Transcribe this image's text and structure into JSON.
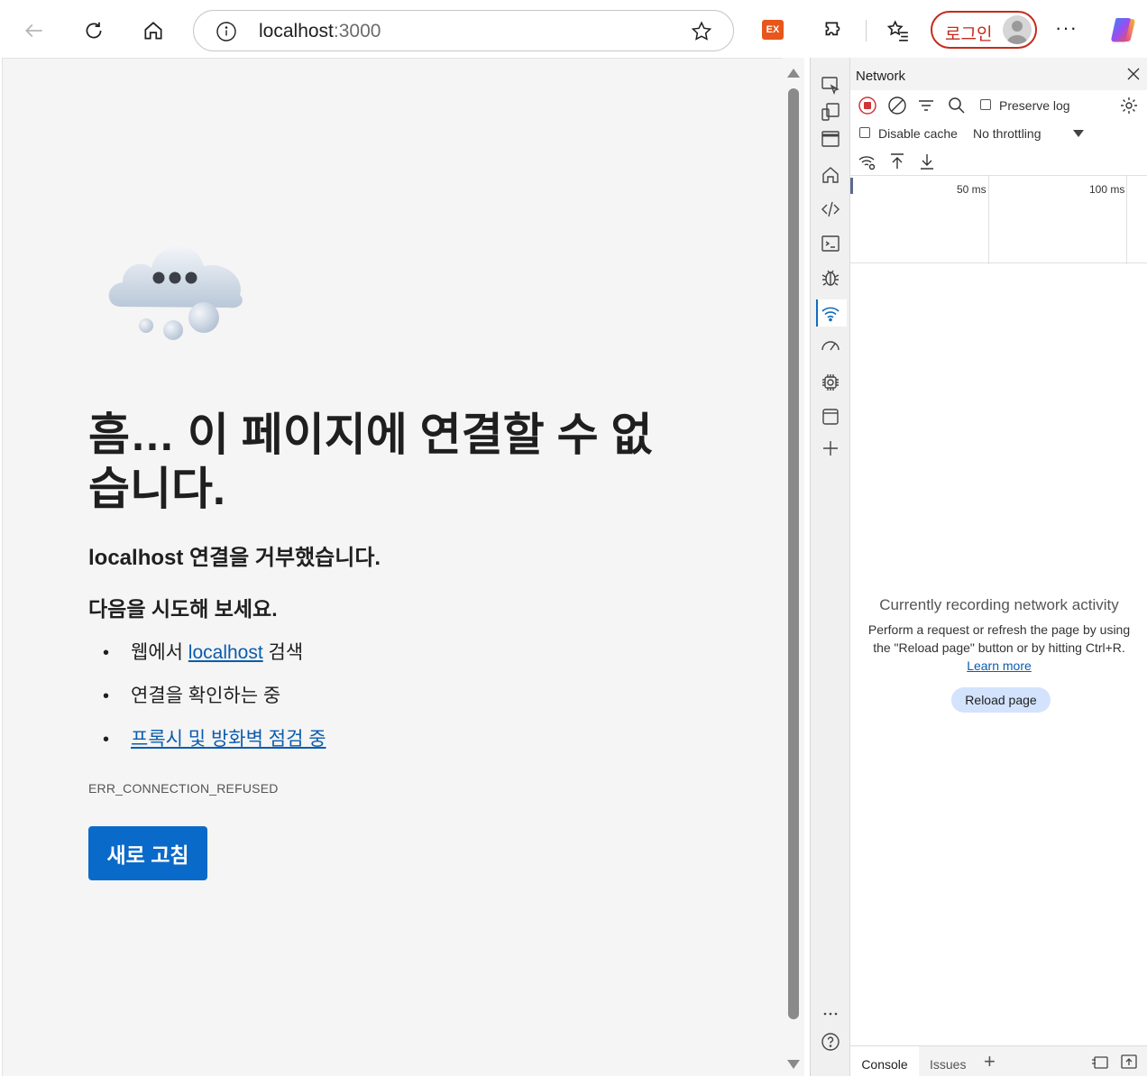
{
  "toolbar": {
    "url_host": "localhost",
    "url_port": ":3000",
    "extension_badge": "EX",
    "login_label": "로그인",
    "more_label": "···"
  },
  "error_page": {
    "title": "흠… 이 페이지에 연결할 수 없습니다.",
    "subtitle": "localhost 연결을 거부했습니다.",
    "subtitle_host": "localhost",
    "subtitle_rest": " 연결을 거부했습니다.",
    "try_heading": "다음을 시도해 보세요.",
    "suggestions": [
      {
        "prefix": "웹에서 ",
        "link": "localhost",
        "suffix": " 검색"
      },
      {
        "prefix": "연결을 확인하는 중",
        "link": "",
        "suffix": ""
      },
      {
        "prefix": "",
        "link": "프록시 및 방화벽 점검 중",
        "suffix": ""
      }
    ],
    "error_code": "ERR_CONNECTION_REFUSED",
    "reload_button": "새로 고침"
  },
  "devtools": {
    "panel_title": "Network",
    "preserve_log_label": "Preserve log",
    "disable_cache_label": "Disable cache",
    "throttling_value": "No throttling",
    "timeline_ticks": [
      "50 ms",
      "100 ms"
    ],
    "empty_title": "Currently recording network activity",
    "empty_desc_before": "Perform a request or refresh the page by using the \"Reload page\" button or by hitting Ctrl+R. ",
    "learn_more": "Learn more",
    "reload_page_button": "Reload page",
    "bottom_tabs": [
      "Console",
      "Issues"
    ]
  },
  "colors": {
    "accent": "#0a6ac9",
    "link": "#0b5cad",
    "login_border": "#c42b1c",
    "page_bg": "#f5f5f5"
  }
}
